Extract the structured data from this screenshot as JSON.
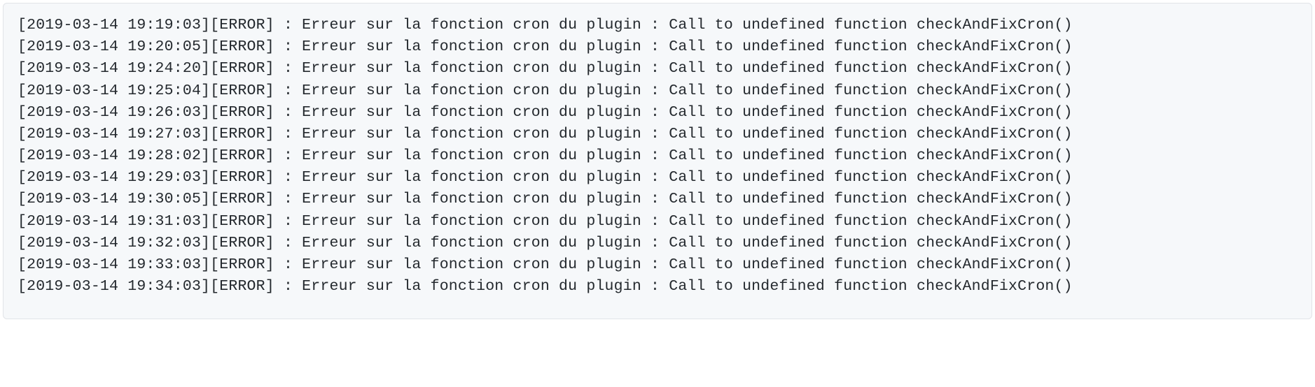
{
  "logs": [
    {
      "timestamp": "2019-03-14 19:19:03",
      "level": "ERROR",
      "message": "Erreur sur la fonction cron du plugin : Call to undefined function checkAndFixCron()"
    },
    {
      "timestamp": "2019-03-14 19:20:05",
      "level": "ERROR",
      "message": "Erreur sur la fonction cron du plugin : Call to undefined function checkAndFixCron()"
    },
    {
      "timestamp": "2019-03-14 19:24:20",
      "level": "ERROR",
      "message": "Erreur sur la fonction cron du plugin : Call to undefined function checkAndFixCron()"
    },
    {
      "timestamp": "2019-03-14 19:25:04",
      "level": "ERROR",
      "message": "Erreur sur la fonction cron du plugin : Call to undefined function checkAndFixCron()"
    },
    {
      "timestamp": "2019-03-14 19:26:03",
      "level": "ERROR",
      "message": "Erreur sur la fonction cron du plugin : Call to undefined function checkAndFixCron()"
    },
    {
      "timestamp": "2019-03-14 19:27:03",
      "level": "ERROR",
      "message": "Erreur sur la fonction cron du plugin : Call to undefined function checkAndFixCron()"
    },
    {
      "timestamp": "2019-03-14 19:28:02",
      "level": "ERROR",
      "message": "Erreur sur la fonction cron du plugin : Call to undefined function checkAndFixCron()"
    },
    {
      "timestamp": "2019-03-14 19:29:03",
      "level": "ERROR",
      "message": "Erreur sur la fonction cron du plugin : Call to undefined function checkAndFixCron()"
    },
    {
      "timestamp": "2019-03-14 19:30:05",
      "level": "ERROR",
      "message": "Erreur sur la fonction cron du plugin : Call to undefined function checkAndFixCron()"
    },
    {
      "timestamp": "2019-03-14 19:31:03",
      "level": "ERROR",
      "message": "Erreur sur la fonction cron du plugin : Call to undefined function checkAndFixCron()"
    },
    {
      "timestamp": "2019-03-14 19:32:03",
      "level": "ERROR",
      "message": "Erreur sur la fonction cron du plugin : Call to undefined function checkAndFixCron()"
    },
    {
      "timestamp": "2019-03-14 19:33:03",
      "level": "ERROR",
      "message": "Erreur sur la fonction cron du plugin : Call to undefined function checkAndFixCron()"
    },
    {
      "timestamp": "2019-03-14 19:34:03",
      "level": "ERROR",
      "message": "Erreur sur la fonction cron du plugin : Call to undefined function checkAndFixCron()"
    }
  ]
}
